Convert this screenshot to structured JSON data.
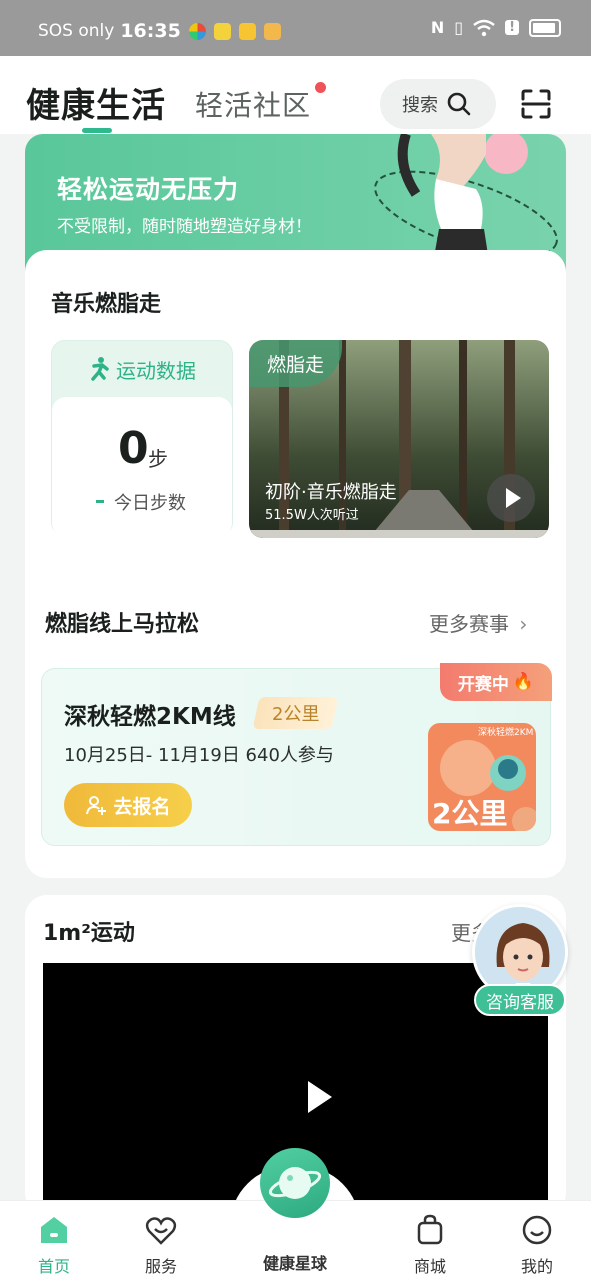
{
  "status_bar": {
    "carrier": "SOS only",
    "time": "16:35"
  },
  "header": {
    "tab_active": "健康生活",
    "tab_other": "轻活社区",
    "search_label": "搜索"
  },
  "banner": {
    "title": "轻松运动无压力",
    "subtitle": "不受限制，随时随地塑造好身材！"
  },
  "music_section": {
    "title": "音乐燃脂走",
    "steps_card": {
      "header": "运动数据",
      "steps": "0",
      "unit": "步",
      "label": "今日步数"
    },
    "video": {
      "tag": "燃脂走",
      "title": "初阶·音乐燃脂走",
      "views": "51.5W人次听过"
    }
  },
  "marathon_section": {
    "title": "燃脂线上马拉松",
    "more": "更多赛事",
    "race": {
      "title": "深秋轻燃2KM线",
      "badge": "2公里",
      "info": "10月25日- 11月19日 640人参与",
      "signup": "去报名",
      "status": "开赛中",
      "art_caption": "深秋轻燃2KM",
      "art_big": "2公里"
    }
  },
  "sport_section": {
    "title": "1m²运动",
    "more": "更多"
  },
  "customer_service": {
    "label": "咨询客服"
  },
  "bottom_nav": {
    "home": "首页",
    "service": "服务",
    "planet": "健康星球",
    "mall": "商城",
    "mine": "我的"
  },
  "colors": {
    "accent": "#2eb389",
    "banner": "#59c79a",
    "signup": "#f0b93a",
    "live": "#f37b6e"
  },
  "icons": [
    "search-icon",
    "scan-icon",
    "run-icon",
    "play-icon",
    "person-add-icon",
    "fire-icon",
    "home-icon",
    "heart-icon",
    "planet-icon",
    "bag-icon",
    "smile-icon",
    "chevron-right-icon"
  ]
}
